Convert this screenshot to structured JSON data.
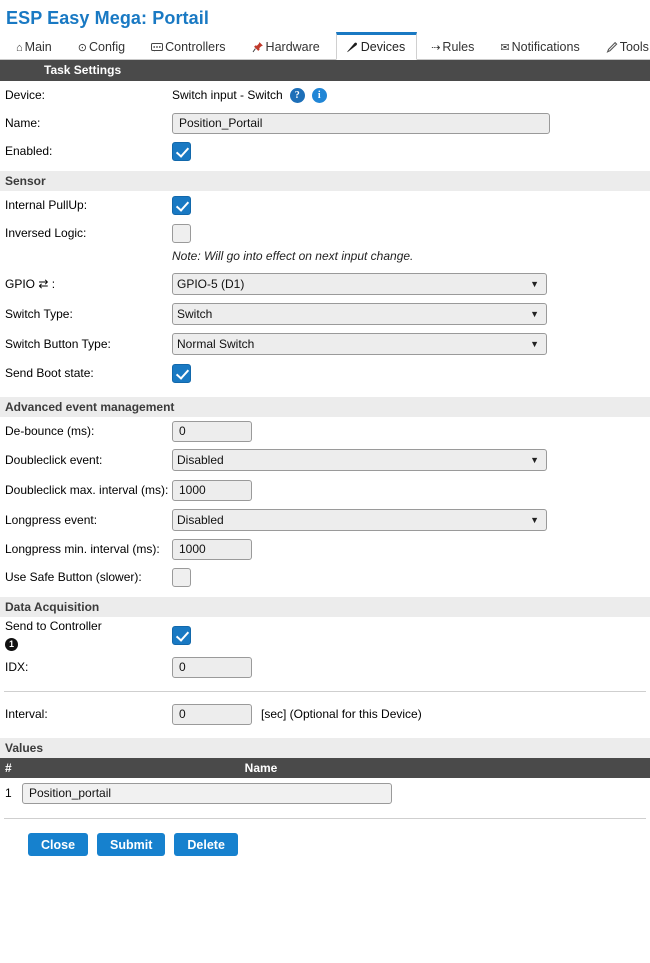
{
  "header": {
    "title": "ESP Easy Mega: Portail"
  },
  "tabs": [
    {
      "label": "Main",
      "icon": "home-icon",
      "glyph": "⌂",
      "active": false
    },
    {
      "label": "Config",
      "icon": "gear-icon",
      "glyph": "⊙",
      "active": false
    },
    {
      "label": "Controllers",
      "icon": "controllers-icon",
      "glyph": "▭",
      "active": false
    },
    {
      "label": "Hardware",
      "icon": "pin-icon",
      "glyph": "📌",
      "active": false
    },
    {
      "label": "Devices",
      "icon": "plug-icon",
      "glyph": "🔌",
      "active": true
    },
    {
      "label": "Rules",
      "icon": "rules-icon",
      "glyph": "⇢",
      "active": false
    },
    {
      "label": "Notifications",
      "icon": "envelope-icon",
      "glyph": "✉",
      "active": false
    },
    {
      "label": "Tools",
      "icon": "wrench-icon",
      "glyph": "✎",
      "active": false
    }
  ],
  "sections": {
    "task_settings": "Task Settings",
    "sensor": "Sensor",
    "advanced": "Advanced event management",
    "data_acquisition": "Data Acquisition",
    "values": "Values"
  },
  "task": {
    "device_label": "Device:",
    "device_value": "Switch input - Switch",
    "help_icon": "?",
    "info_icon": "i",
    "name_label": "Name:",
    "name_value": "Position_Portail",
    "name_placeholder": "",
    "enabled_label": "Enabled:",
    "enabled_checked": true
  },
  "sensor": {
    "pullup_label": "Internal PullUp:",
    "pullup_checked": true,
    "inversed_label": "Inversed Logic:",
    "inversed_checked": false,
    "note": "Note: Will go into effect on next input change.",
    "gpio_label": "GPIO ⇄ :",
    "gpio_value": "GPIO-5 (D1)",
    "gpio_options": [
      "GPIO-5 (D1)"
    ],
    "switch_type_label": "Switch Type:",
    "switch_type_value": "Switch",
    "switch_type_options": [
      "Switch"
    ],
    "button_type_label": "Switch Button Type:",
    "button_type_value": "Normal Switch",
    "button_type_options": [
      "Normal Switch"
    ],
    "boot_state_label": "Send Boot state:",
    "boot_state_checked": true
  },
  "advanced": {
    "debounce_label": "De-bounce (ms):",
    "debounce_value": "0",
    "doubleclick_label": "Doubleclick event:",
    "doubleclick_value": "Disabled",
    "doubleclick_options": [
      "Disabled"
    ],
    "doubleclick_interval_label": "Doubleclick max. interval (ms):",
    "doubleclick_interval_value": "1000",
    "longpress_label": "Longpress event:",
    "longpress_value": "Disabled",
    "longpress_options": [
      "Disabled"
    ],
    "longpress_interval_label": "Longpress min. interval (ms):",
    "longpress_interval_value": "1000",
    "safe_button_label": "Use Safe Button (slower):",
    "safe_button_checked": false
  },
  "data_acquisition": {
    "send_to_controller_label": "Send to Controller",
    "controller_index": "1",
    "send_checked": true,
    "idx_label": "IDX:",
    "idx_value": "0"
  },
  "interval": {
    "label": "Interval:",
    "value": "0",
    "suffix": "[sec] (Optional for this Device)"
  },
  "values_table": {
    "columns": [
      "#",
      "Name"
    ],
    "rows": [
      {
        "index": "1",
        "name": "Position_portail"
      }
    ]
  },
  "buttons": {
    "close": "Close",
    "submit": "Submit",
    "delete": "Delete"
  },
  "colors": {
    "accent_blue": "#1979c3",
    "button_blue": "#1681ce",
    "dark_bar": "#4a4a4a",
    "light_bar": "#ececec"
  }
}
